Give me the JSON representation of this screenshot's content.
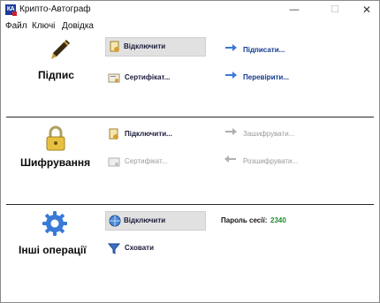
{
  "window": {
    "title": "Крипто-Автограф",
    "icon_label": "КА"
  },
  "menu": [
    "Файл",
    "Ключі",
    "Довідка"
  ],
  "sections": [
    {
      "title": "Підпис",
      "icon": "pen-icon"
    },
    {
      "title": "Шифрування",
      "icon": "lock-icon"
    },
    {
      "title": "Інші операції",
      "icon": "gear-icon"
    }
  ],
  "signature": {
    "disconnect": "Відключити",
    "certificate": "Сертифікат...",
    "sign": "Підписати...",
    "verify": "Перевірити..."
  },
  "encryption": {
    "disconnect": "Підключити...",
    "certificate": "Сертифікат...",
    "encrypt": "Зашифрувати...",
    "decrypt": "Розшифрувати..."
  },
  "other": {
    "disconnect": "Відключити",
    "hide": "Сховати",
    "password_label": "Пароль сесії:",
    "password_value": "2340"
  },
  "colors": {
    "accent": "#3a78d8",
    "password": "#1e8a2a",
    "selected_bg": "#e1e1e1"
  }
}
